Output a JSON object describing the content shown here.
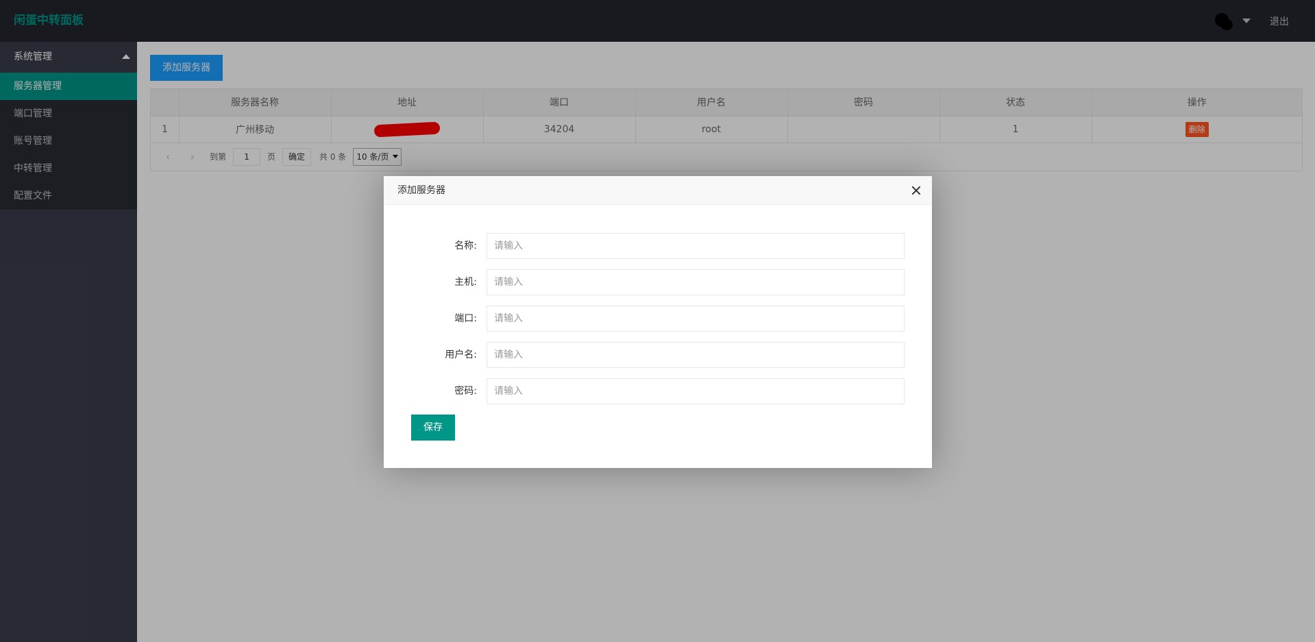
{
  "header": {
    "logo": "闲蛋中转面板",
    "avatar_icon": "avatar-icon",
    "logout_label": "退出"
  },
  "sidebar": {
    "group_label": "系统管理",
    "items": [
      {
        "label": "服务器管理",
        "active": true
      },
      {
        "label": "端口管理"
      },
      {
        "label": "账号管理"
      },
      {
        "label": "中转管理"
      },
      {
        "label": "配置文件"
      }
    ]
  },
  "toolbar": {
    "add_label": "添加服务器"
  },
  "table": {
    "headers": [
      "",
      "服务器名称",
      "地址",
      "端口",
      "用户名",
      "密码",
      "状态",
      "操作"
    ],
    "rows": [
      {
        "index": "1",
        "name": "广州移动",
        "address": "",
        "port": "34204",
        "username": "root",
        "password": "",
        "status": "1",
        "action": "删除"
      }
    ]
  },
  "pager": {
    "goto_label": "到第",
    "page_value": "1",
    "page_unit": "页",
    "confirm_label": "确定",
    "count_label": "共 0 条",
    "limit_label": "10 条/页"
  },
  "modal": {
    "title": "添加服务器",
    "fields": [
      {
        "label": "名称:",
        "placeholder": "请输入"
      },
      {
        "label": "主机:",
        "placeholder": "请输入"
      },
      {
        "label": "端口:",
        "placeholder": "请输入"
      },
      {
        "label": "用户名:",
        "placeholder": "请输入"
      },
      {
        "label": "密码:",
        "placeholder": "请输入"
      }
    ],
    "save_label": "保存"
  },
  "colors": {
    "accent": "#009688",
    "primary": "#1e9fff",
    "danger": "#ff5722",
    "header_bg": "#23262e",
    "sidebar_bg": "#393d49"
  }
}
